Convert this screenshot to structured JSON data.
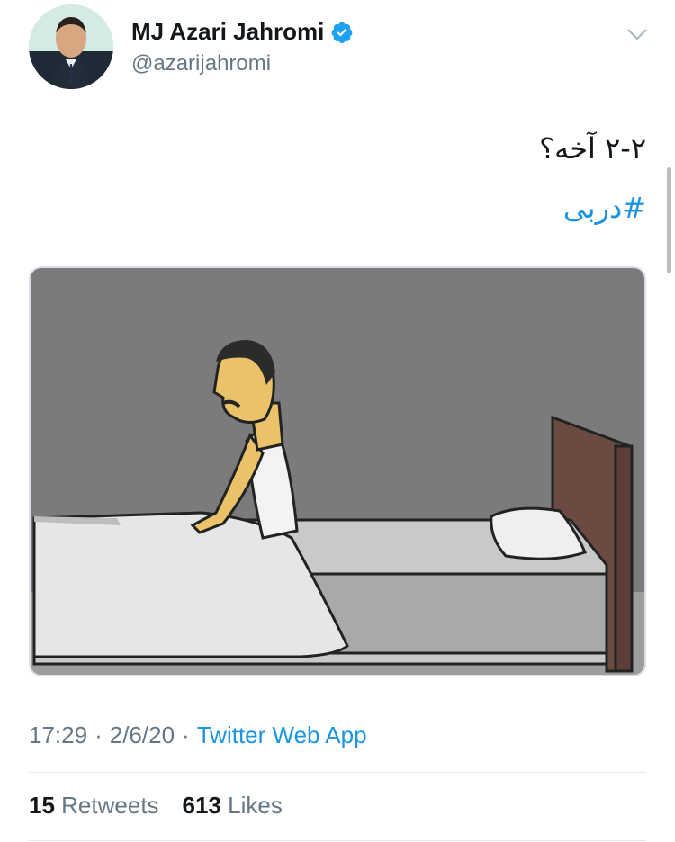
{
  "user": {
    "display_name": "MJ Azari Jahromi",
    "handle": "@azarijahromi",
    "avatar_icon": "profile-photo",
    "verified_icon": "verified-badge-icon",
    "verified_color": "#1da1f2"
  },
  "tweet": {
    "text": "۲-۲ آخه؟",
    "hashtag": "#دربی",
    "hashtag_color": "#1b95e0",
    "media_icon": "cartoon-man-sitting-on-bed-image"
  },
  "meta": {
    "time": "17:29",
    "separator": "·",
    "date": "2/6/20",
    "source": "Twitter Web App"
  },
  "stats": {
    "retweets_count": "15",
    "retweets_label": "Retweets",
    "likes_count": "613",
    "likes_label": "Likes"
  },
  "menu_icon": "chevron-down-icon"
}
